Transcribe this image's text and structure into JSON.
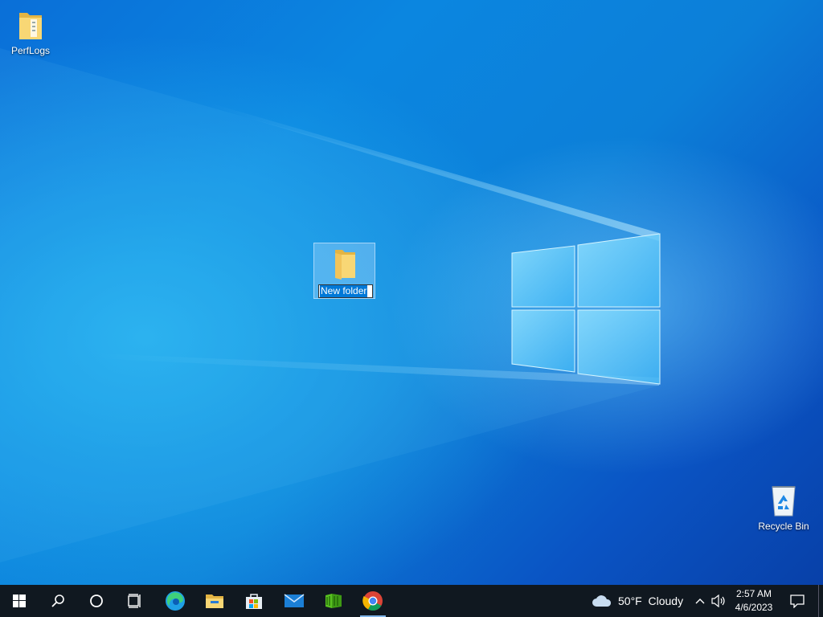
{
  "desktop": {
    "icons": [
      {
        "label": "PerfLogs",
        "icon": "folder-icon"
      },
      {
        "label": "New folder",
        "icon": "folder-icon",
        "state": "renaming"
      },
      {
        "label": "Recycle Bin",
        "icon": "recycle-bin-icon"
      }
    ]
  },
  "taskbar": {
    "apps": [
      "start-icon",
      "search-icon",
      "cortana-icon",
      "task-view-icon",
      "edge-icon",
      "file-explorer-icon",
      "store-icon",
      "mail-icon",
      "minecraft-icon",
      "chrome-icon"
    ],
    "weather": {
      "temperature": "50°F",
      "condition": "Cloudy",
      "icon": "cloud-icon"
    },
    "clock": {
      "time": "2:57 AM",
      "date": "4/6/2023"
    }
  },
  "colors": {
    "accent": "#0078d7",
    "taskbar": "#101820",
    "folder": "#f8d775"
  }
}
